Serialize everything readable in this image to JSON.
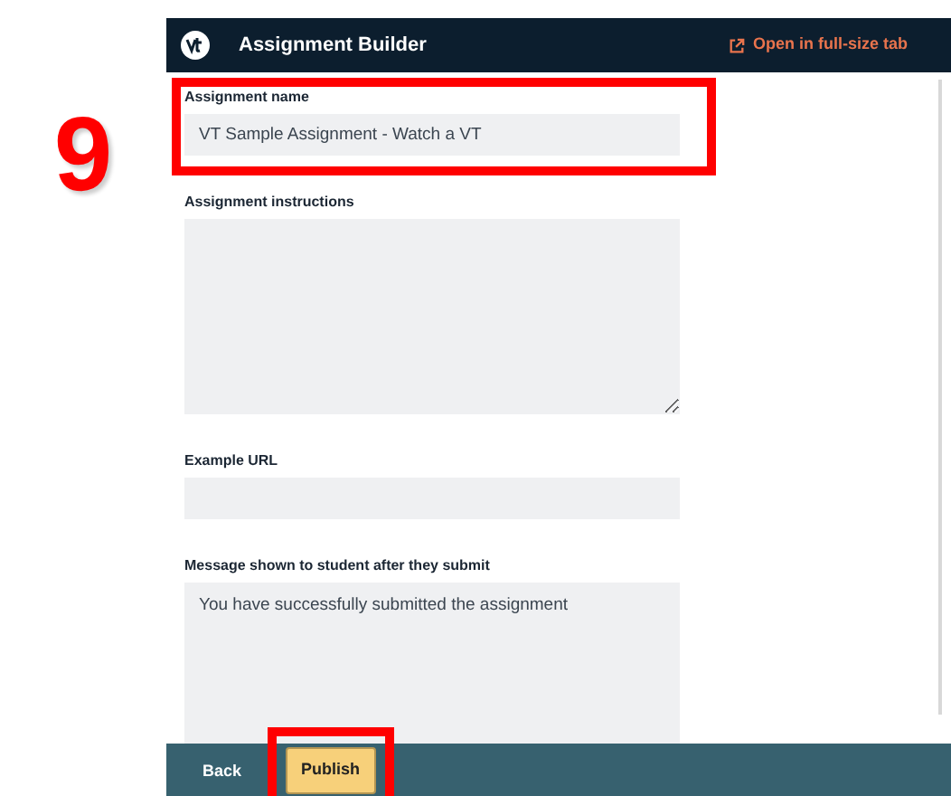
{
  "step_number": "9",
  "header": {
    "title": "Assignment Builder",
    "link": "Open in full-size tab"
  },
  "fields": [
    {
      "label": "Assignment name",
      "kind": "input",
      "value": "VT Sample Assignment - Watch a VT",
      "highlighted": true
    },
    {
      "label": "Assignment instructions",
      "kind": "textarea",
      "resizable": true,
      "highlighted": false
    },
    {
      "label": "Example URL",
      "kind": "input",
      "highlighted": false
    },
    {
      "label": "Message shown to student after they submit",
      "kind": "textarea",
      "value": "You have successfully submitted the assignment",
      "resizable": false,
      "highlighted": false
    }
  ],
  "footer_buttons": [
    {
      "label": "Back",
      "kind": "link",
      "highlighted": false
    },
    {
      "label": "Publish",
      "kind": "primary",
      "highlighted": true
    }
  ]
}
